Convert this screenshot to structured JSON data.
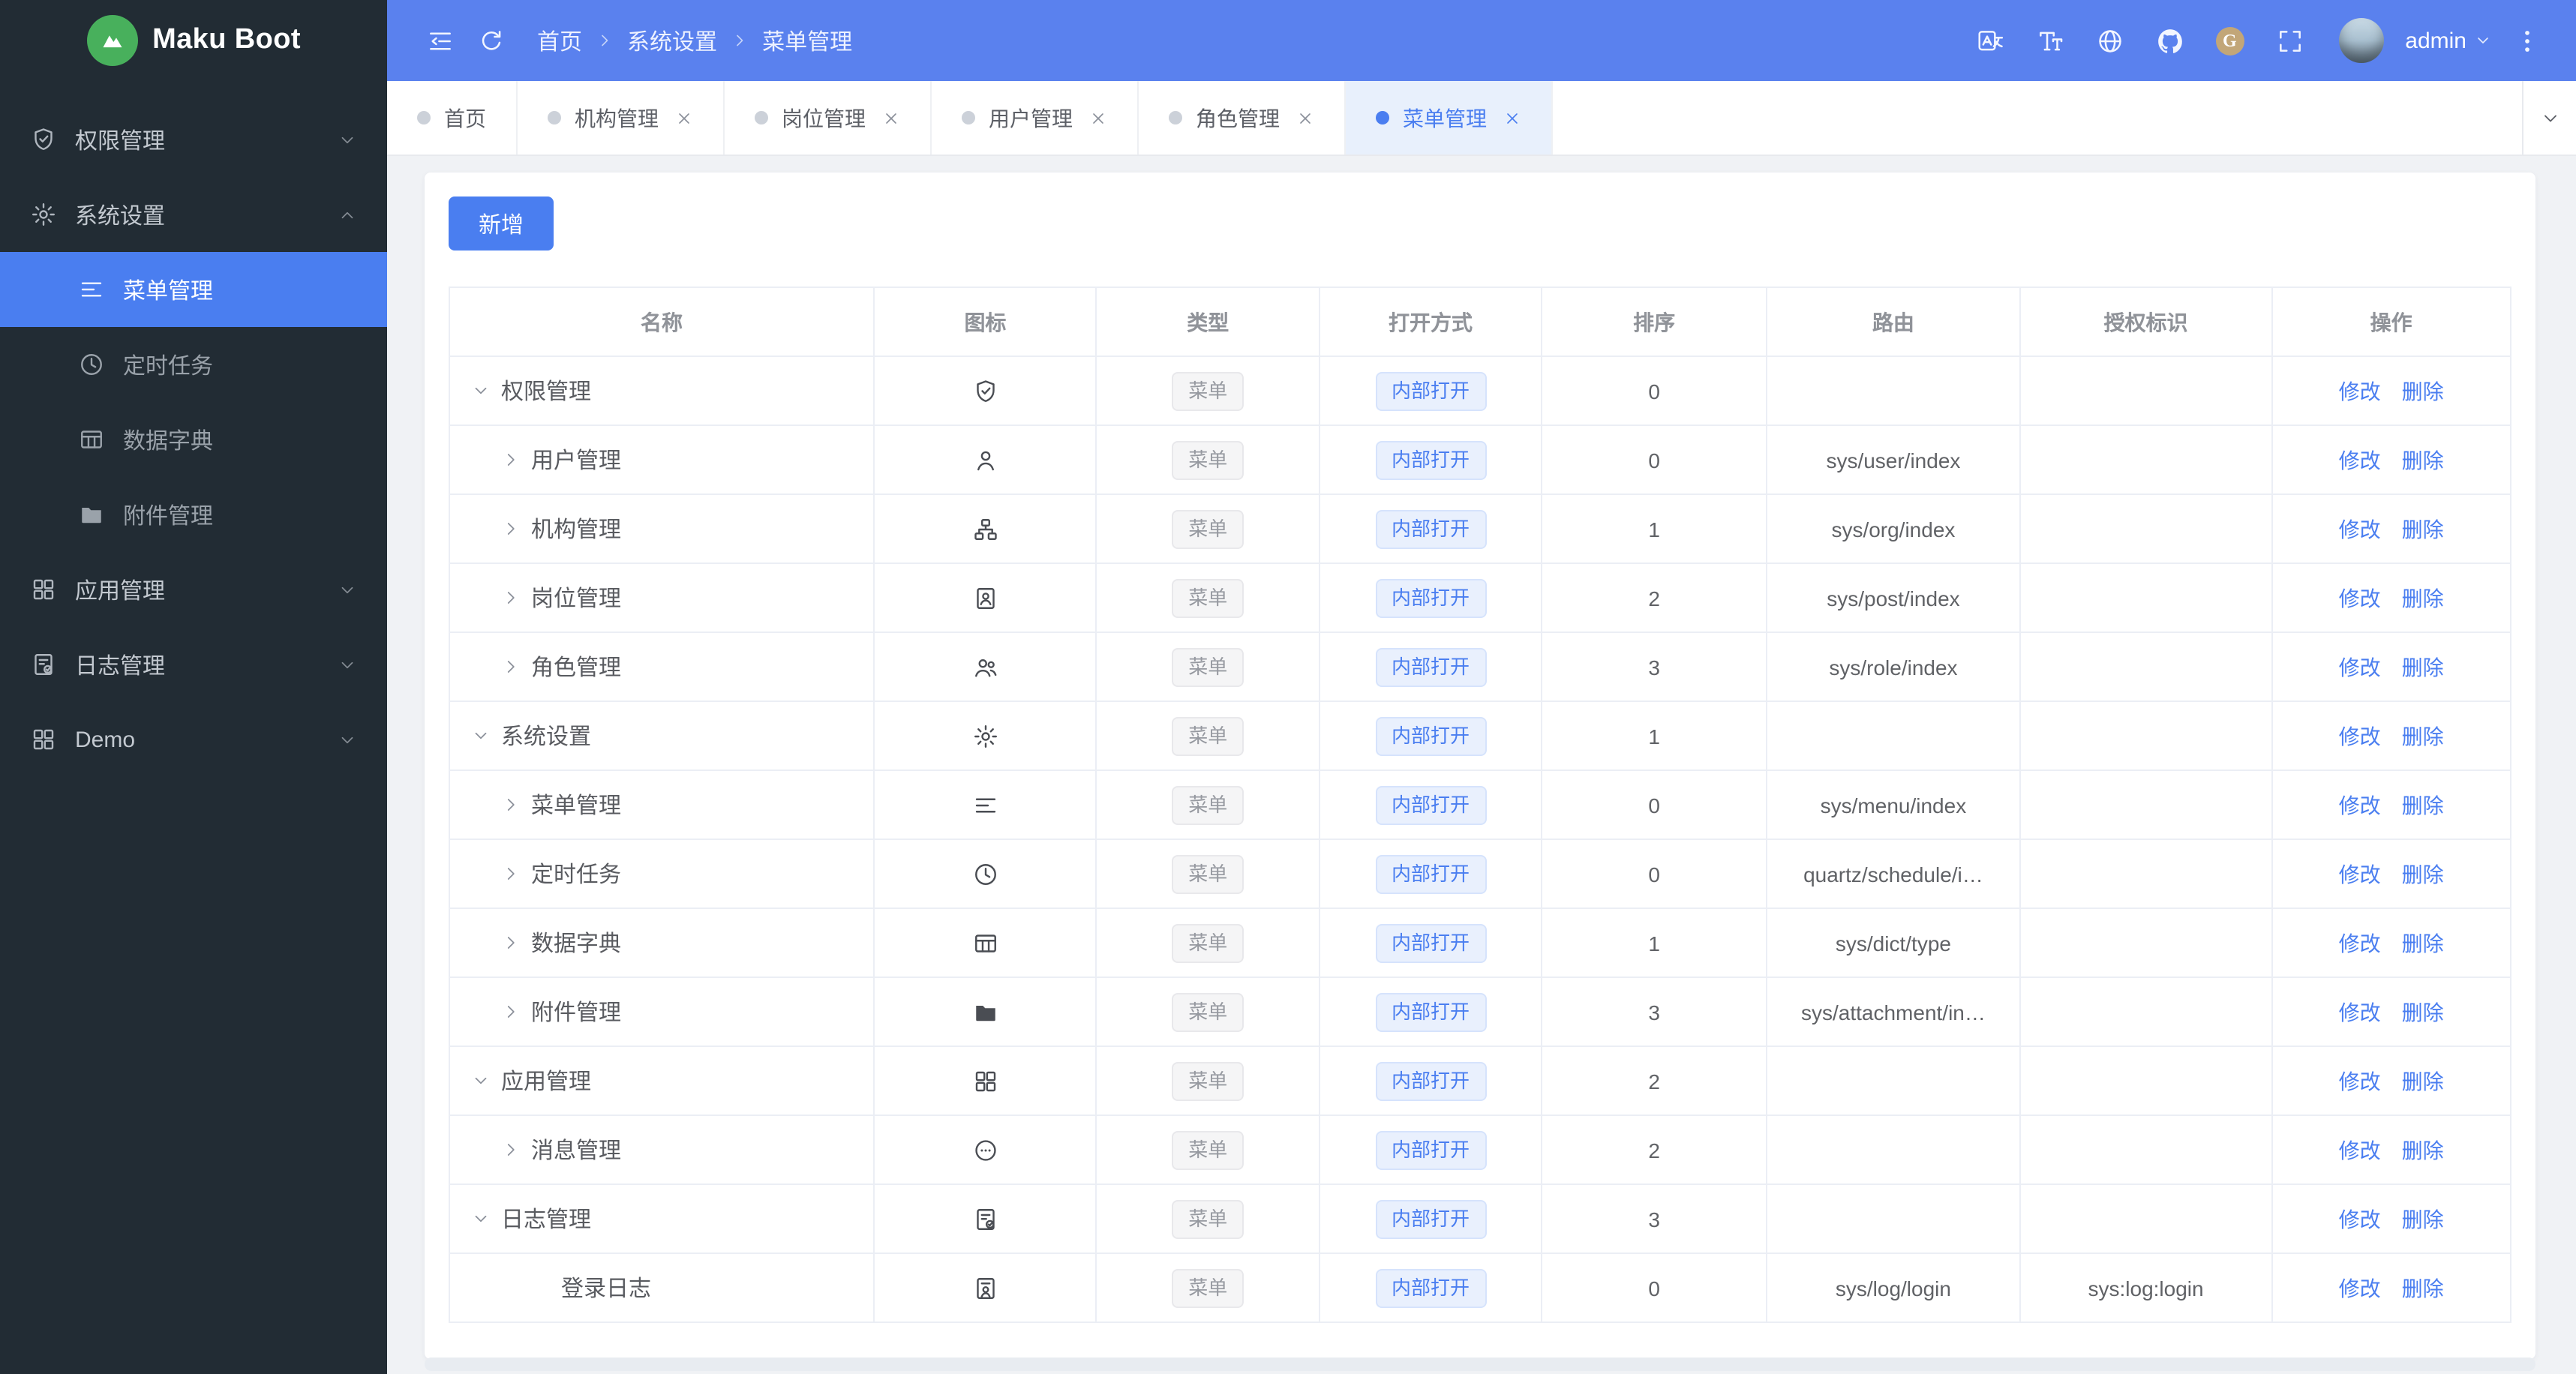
{
  "app": {
    "name": "Maku Boot"
  },
  "colors": {
    "primary": "#4a7ef0",
    "header_bg": "#5a81ee",
    "sidebar_bg": "#222c34",
    "sidebar_active_bg": "#4a7ef0",
    "logo_green": "#48b05c",
    "content_bg": "#f0f2f5",
    "tag_open_bg": "#e9f0fd",
    "tag_type_bg": "#f5f5f6",
    "gitee_tan": "#c2a678"
  },
  "header": {
    "breadcrumb": [
      "首页",
      "系统设置",
      "菜单管理"
    ],
    "icons": [
      "collapse-icon",
      "refresh-icon"
    ],
    "right_icons": [
      "translate-icon",
      "font-size-icon",
      "globe-icon",
      "github-icon",
      "gitee-icon",
      "fullscreen-icon"
    ],
    "user": {
      "name": "admin"
    }
  },
  "sidebar": {
    "items": [
      {
        "key": "auth",
        "label": "权限管理",
        "icon": "shield-check-icon",
        "caret": "down"
      },
      {
        "key": "system",
        "label": "系统设置",
        "icon": "gear-icon",
        "caret": "up",
        "expanded": true,
        "children": [
          {
            "key": "menu",
            "label": "菜单管理",
            "icon": "menu-icon",
            "active": true
          },
          {
            "key": "schedule",
            "label": "定时任务",
            "icon": "clock-icon"
          },
          {
            "key": "dict",
            "label": "数据字典",
            "icon": "dict-table-icon"
          },
          {
            "key": "attachment",
            "label": "附件管理",
            "icon": "folder-icon"
          }
        ]
      },
      {
        "key": "app",
        "label": "应用管理",
        "icon": "grid-icon",
        "caret": "down"
      },
      {
        "key": "log",
        "label": "日志管理",
        "icon": "log-icon",
        "caret": "down"
      },
      {
        "key": "demo",
        "label": "Demo",
        "icon": "grid-icon",
        "caret": "down"
      }
    ]
  },
  "tabs": [
    {
      "key": "home",
      "label": "首页",
      "closable": false,
      "active": false
    },
    {
      "key": "org",
      "label": "机构管理",
      "closable": true,
      "active": false
    },
    {
      "key": "post",
      "label": "岗位管理",
      "closable": true,
      "active": false
    },
    {
      "key": "user",
      "label": "用户管理",
      "closable": true,
      "active": false
    },
    {
      "key": "role",
      "label": "角色管理",
      "closable": true,
      "active": false
    },
    {
      "key": "menu",
      "label": "菜单管理",
      "closable": true,
      "active": true
    }
  ],
  "toolbar": {
    "add_label": "新增"
  },
  "table": {
    "columns": [
      "名称",
      "图标",
      "类型",
      "打开方式",
      "排序",
      "路由",
      "授权标识",
      "操作"
    ],
    "col_widths": [
      "20.6%",
      "10.8%",
      "10.8%",
      "10.8%",
      "10.9%",
      "12.3%",
      "12.2%",
      "11.6%"
    ],
    "actions": {
      "edit": "修改",
      "delete": "删除"
    },
    "rows": [
      {
        "name": "权限管理",
        "level": 1,
        "arrow": "down",
        "icon": "shield-check-icon",
        "type": "菜单",
        "open": "内部打开",
        "sort": "0",
        "route": "",
        "perm": ""
      },
      {
        "name": "用户管理",
        "level": 2,
        "arrow": "right",
        "icon": "user-icon",
        "type": "菜单",
        "open": "内部打开",
        "sort": "0",
        "route": "sys/user/index",
        "perm": ""
      },
      {
        "name": "机构管理",
        "level": 2,
        "arrow": "right",
        "icon": "org-icon",
        "type": "菜单",
        "open": "内部打开",
        "sort": "1",
        "route": "sys/org/index",
        "perm": ""
      },
      {
        "name": "岗位管理",
        "level": 2,
        "arrow": "right",
        "icon": "badge-icon",
        "type": "菜单",
        "open": "内部打开",
        "sort": "2",
        "route": "sys/post/index",
        "perm": ""
      },
      {
        "name": "角色管理",
        "level": 2,
        "arrow": "right",
        "icon": "role-icon",
        "type": "菜单",
        "open": "内部打开",
        "sort": "3",
        "route": "sys/role/index",
        "perm": ""
      },
      {
        "name": "系统设置",
        "level": 1,
        "arrow": "down",
        "icon": "gear-icon",
        "type": "菜单",
        "open": "内部打开",
        "sort": "1",
        "route": "",
        "perm": ""
      },
      {
        "name": "菜单管理",
        "level": 2,
        "arrow": "right",
        "icon": "menu-icon",
        "type": "菜单",
        "open": "内部打开",
        "sort": "0",
        "route": "sys/menu/index",
        "perm": ""
      },
      {
        "name": "定时任务",
        "level": 2,
        "arrow": "right",
        "icon": "clock-icon",
        "type": "菜单",
        "open": "内部打开",
        "sort": "0",
        "route": "quartz/schedule/i…",
        "perm": ""
      },
      {
        "name": "数据字典",
        "level": 2,
        "arrow": "right",
        "icon": "dict-table-icon",
        "type": "菜单",
        "open": "内部打开",
        "sort": "1",
        "route": "sys/dict/type",
        "perm": ""
      },
      {
        "name": "附件管理",
        "level": 2,
        "arrow": "right",
        "icon": "folder-icon",
        "type": "菜单",
        "open": "内部打开",
        "sort": "3",
        "route": "sys/attachment/in…",
        "perm": ""
      },
      {
        "name": "应用管理",
        "level": 1,
        "arrow": "down",
        "icon": "grid-icon",
        "type": "菜单",
        "open": "内部打开",
        "sort": "2",
        "route": "",
        "perm": ""
      },
      {
        "name": "消息管理",
        "level": 2,
        "arrow": "right",
        "icon": "message-icon",
        "type": "菜单",
        "open": "内部打开",
        "sort": "2",
        "route": "",
        "perm": ""
      },
      {
        "name": "日志管理",
        "level": 1,
        "arrow": "down",
        "icon": "log-icon",
        "type": "菜单",
        "open": "内部打开",
        "sort": "3",
        "route": "",
        "perm": ""
      },
      {
        "name": "登录日志",
        "level": 3,
        "arrow": "none",
        "icon": "login-log-icon",
        "type": "菜单",
        "open": "内部打开",
        "sort": "0",
        "route": "sys/log/login",
        "perm": "sys:log:login"
      }
    ]
  }
}
